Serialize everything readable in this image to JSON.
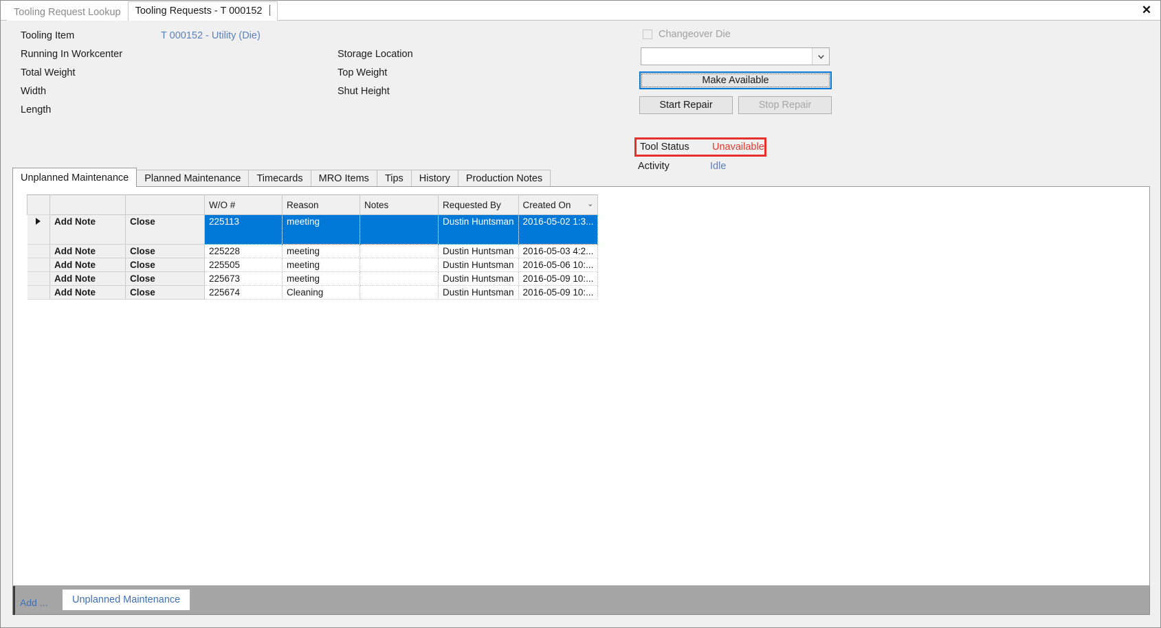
{
  "window": {
    "close_label": "✕",
    "tabs": [
      {
        "label": "Tooling Request Lookup",
        "active": false
      },
      {
        "label": "Tooling Requests - T 000152",
        "active": true
      }
    ]
  },
  "header": {
    "left_fields": [
      {
        "label": "Tooling Item",
        "value": "T 000152 - Utility (Die)"
      },
      {
        "label": "Running In Workcenter",
        "value": ""
      },
      {
        "label": "Total Weight",
        "value": ""
      },
      {
        "label": "Width",
        "value": ""
      },
      {
        "label": "Length",
        "value": ""
      }
    ],
    "mid_fields": [
      {
        "label": "Storage Location",
        "value": ""
      },
      {
        "label": "Top Weight",
        "value": ""
      },
      {
        "label": "Shut Height",
        "value": ""
      }
    ],
    "changeover": {
      "label": "Changeover Die",
      "checked": false
    },
    "combo": {
      "value": "",
      "placeholder": ""
    },
    "buttons": {
      "make_available": "Make Available",
      "start_repair": "Start Repair",
      "stop_repair": "Stop Repair"
    },
    "tool_status": {
      "label": "Tool Status",
      "value": "Unavailable",
      "highlight_color": "#e8302a",
      "value_color": "#e0392f"
    },
    "activity": {
      "label": "Activity",
      "value": "Idle",
      "value_color": "#5b7fbb"
    }
  },
  "inner_tabs": [
    {
      "label": "Unplanned Maintenance",
      "active": true
    },
    {
      "label": "Planned Maintenance",
      "active": false
    },
    {
      "label": "Timecards",
      "active": false
    },
    {
      "label": "MRO Items",
      "active": false
    },
    {
      "label": "Tips",
      "active": false
    },
    {
      "label": "History",
      "active": false
    },
    {
      "label": "Production Notes",
      "active": false
    }
  ],
  "grid": {
    "columns": [
      "",
      "",
      "",
      "W/O #",
      "Reason",
      "Notes",
      "Requested By",
      "Created On"
    ],
    "sort_column": "Created On",
    "sort_indicator": "⌄",
    "action_add_note": "Add Note",
    "action_close": "Close",
    "rows": [
      {
        "selected": true,
        "marker": "▶",
        "add_note": "Add Note",
        "close": "Close",
        "wo": "225113",
        "reason": "meeting",
        "notes": "",
        "requested_by": "Dustin Huntsman",
        "created_on": "2016-05-02  1:3..."
      },
      {
        "selected": false,
        "marker": "",
        "add_note": "Add Note",
        "close": "Close",
        "wo": "225228",
        "reason": "meeting",
        "notes": "",
        "requested_by": "Dustin Huntsman",
        "created_on": "2016-05-03  4:2..."
      },
      {
        "selected": false,
        "marker": "",
        "add_note": "Add Note",
        "close": "Close",
        "wo": "225505",
        "reason": "meeting",
        "notes": "",
        "requested_by": "Dustin Huntsman",
        "created_on": "2016-05-06  10:..."
      },
      {
        "selected": false,
        "marker": "",
        "add_note": "Add Note",
        "close": "Close",
        "wo": "225673",
        "reason": "meeting",
        "notes": "",
        "requested_by": "Dustin Huntsman",
        "created_on": "2016-05-09  10:..."
      },
      {
        "selected": false,
        "marker": "",
        "add_note": "Add Note",
        "close": "Close",
        "wo": "225674",
        "reason": "Cleaning",
        "notes": "",
        "requested_by": "Dustin Huntsman",
        "created_on": "2016-05-09  10:..."
      }
    ]
  },
  "bottom_bar": {
    "add_label": "Add ...",
    "active_tab": "Unplanned Maintenance"
  },
  "colors": {
    "accent": "#0078d7",
    "link": "#5b7fbb",
    "alert": "#e8302a",
    "window_bg": "#f0f0f0",
    "bottom_bar": "#a6a6a6"
  }
}
